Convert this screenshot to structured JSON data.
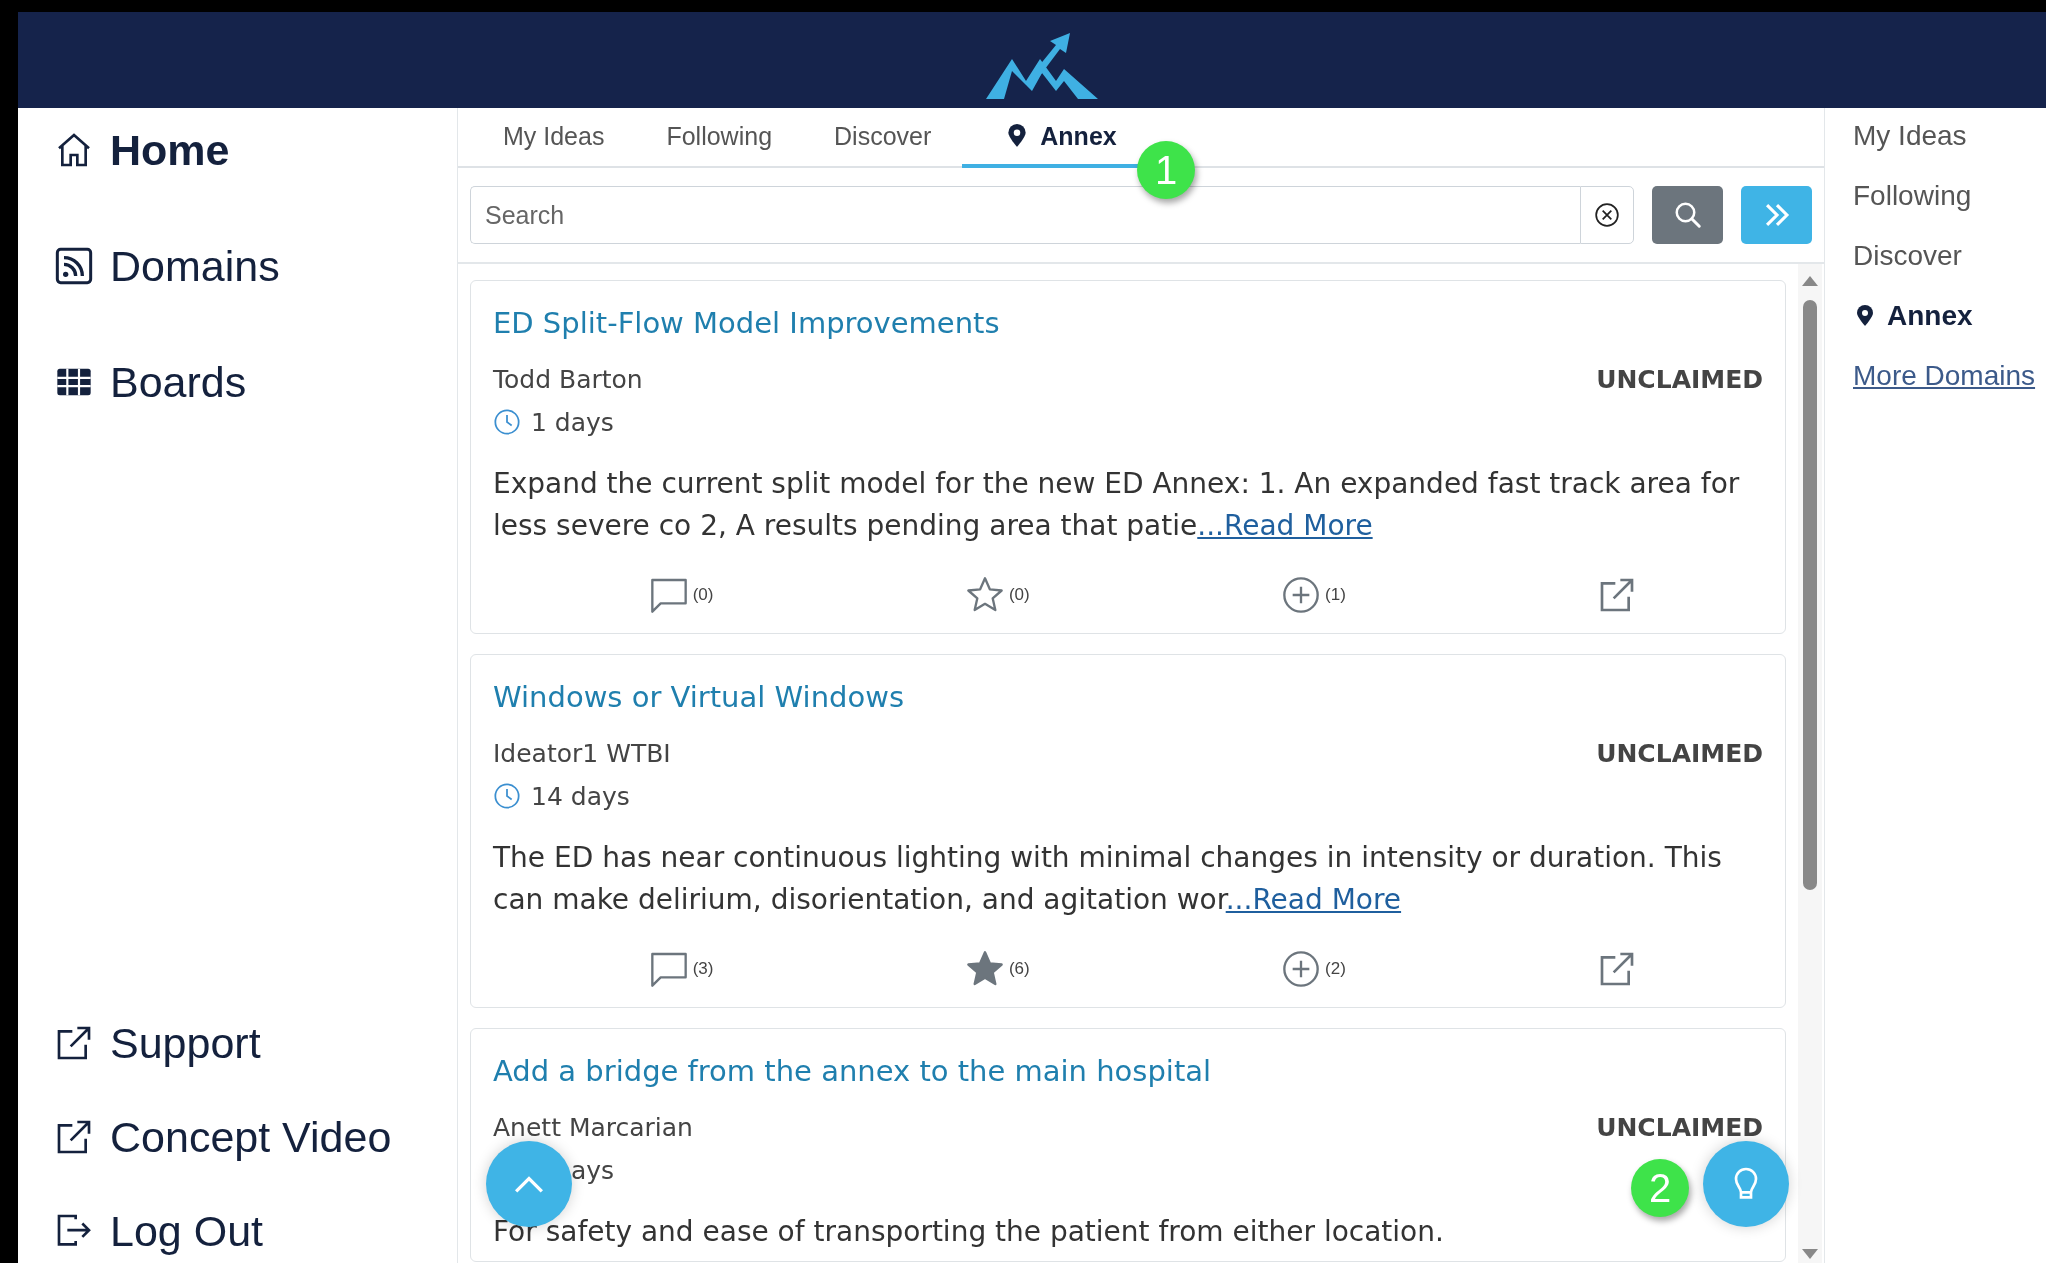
{
  "sidebar": {
    "top_items": [
      {
        "label": "Home",
        "kind": "home",
        "selected": true
      },
      {
        "label": "Domains",
        "kind": "feed",
        "selected": false
      },
      {
        "label": "Boards",
        "kind": "boards",
        "selected": false
      }
    ],
    "bottom_items": [
      {
        "label": "Support",
        "kind": "external"
      },
      {
        "label": "Concept Video",
        "kind": "external"
      },
      {
        "label": "Log Out",
        "kind": "logout"
      }
    ]
  },
  "tabs": [
    {
      "label": "My Ideas",
      "kind": "text",
      "selected": false
    },
    {
      "label": "Following",
      "kind": "text",
      "selected": false
    },
    {
      "label": "Discover",
      "kind": "text",
      "selected": false
    },
    {
      "label": "Annex",
      "kind": "location",
      "selected": true
    }
  ],
  "markers": [
    {
      "label": "1"
    },
    {
      "label": "2"
    }
  ],
  "search": {
    "placeholder": "Search"
  },
  "ideas": [
    {
      "title": "ED Split-Flow Model Improvements",
      "author": "Todd Barton",
      "status": "UNCLAIMED",
      "age": "1 days",
      "body": "Expand the current split model for the new ED Annex: 1. An expanded fast track area for less severe co 2, A results pending area that patie",
      "read_more": "...Read More",
      "comments": "(0)",
      "stars": "(0)",
      "starred": false,
      "adds": "(1)"
    },
    {
      "title": "Windows or Virtual Windows",
      "author": "Ideator1 WTBI",
      "status": "UNCLAIMED",
      "age": "14 days",
      "body": "The ED has near continuous lighting with minimal changes in intensity or duration. This can make delirium, disorientation, and agitation wor",
      "read_more": "...Read More",
      "comments": "(3)",
      "stars": "(6)",
      "starred": true,
      "adds": "(2)"
    },
    {
      "title": "Add a bridge from the annex to the main hospital",
      "author": "Anett Marcarian",
      "status": "UNCLAIMED",
      "age": "ays",
      "body": "For safety and ease of transporting the patient from either location."
    }
  ],
  "side_nav": {
    "items": [
      {
        "label": "My Ideas",
        "kind": "text",
        "selected": false
      },
      {
        "label": "Following",
        "kind": "text",
        "selected": false
      },
      {
        "label": "Discover",
        "kind": "text",
        "selected": false
      },
      {
        "label": "Annex",
        "kind": "location",
        "selected": true
      }
    ],
    "more_link": "More Domains"
  }
}
